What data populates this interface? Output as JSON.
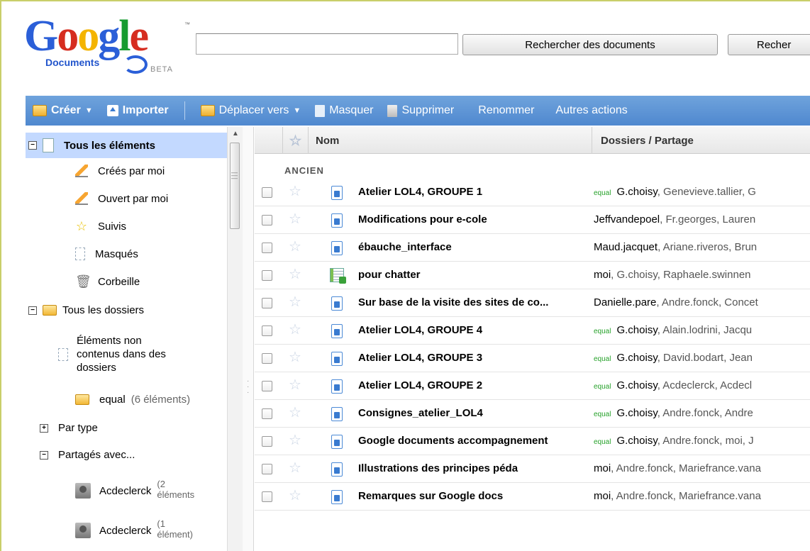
{
  "header": {
    "logo_word": "Google",
    "logo_sub": "Documents",
    "logo_beta": "BETA",
    "search_value": "",
    "btn_search_docs": "Rechercher des documents",
    "btn_search_web": "Recher"
  },
  "toolbar": {
    "create": "Créer",
    "import": "Importer",
    "move": "Déplacer vers",
    "hide": "Masquer",
    "delete": "Supprimer",
    "rename": "Renommer",
    "more": "Autres actions"
  },
  "sidebar": {
    "all_items": "Tous les éléments",
    "created_by_me": "Créés par moi",
    "opened_by_me": "Ouvert par moi",
    "starred": "Suivis",
    "hidden": "Masqués",
    "trash": "Corbeille",
    "all_folders": "Tous les dossiers",
    "unfiled_line1": "Éléments non",
    "unfiled_line2": "contenus dans des",
    "unfiled_line3": "dossiers",
    "folder_equal": "equal",
    "folder_equal_count": "(6 éléments)",
    "by_type": "Par type",
    "shared_with": "Partagés avec...",
    "contacts": [
      {
        "name": "Acdeclerck",
        "count_a": "(2",
        "count_b": "éléments"
      },
      {
        "name": "Acdeclerck",
        "count_a": "(1",
        "count_b": "élément)"
      }
    ]
  },
  "list": {
    "col_name": "Nom",
    "col_folders": "Dossiers / Partage",
    "group": "ANCIEN",
    "rows": [
      {
        "title": "Atelier LOL4, GROUPE 1",
        "type": "doc",
        "tag": "equal",
        "first": "G.choisy",
        "rest": ", Genevieve.tallier, G"
      },
      {
        "title": "Modifications pour e-cole",
        "type": "doc",
        "tag": "",
        "first": "Jeffvandepoel",
        "rest": ", Fr.georges, Lauren"
      },
      {
        "title": "ébauche_interface",
        "type": "doc",
        "tag": "",
        "first": "Maud.jacquet",
        "rest": ", Ariane.riveros, Brun"
      },
      {
        "title": "pour chatter",
        "type": "sheet",
        "tag": "",
        "first": "moi",
        "rest": ", G.choisy, Raphaele.swinnen"
      },
      {
        "title": "Sur base de la visite des sites de co...",
        "type": "doc",
        "tag": "",
        "first": "Danielle.pare",
        "rest": ", Andre.fonck, Concet"
      },
      {
        "title": "Atelier LOL4, GROUPE 4",
        "type": "doc",
        "tag": "equal",
        "first": "G.choisy",
        "rest": ", Alain.lodrini, Jacqu"
      },
      {
        "title": "Atelier LOL4, GROUPE 3",
        "type": "doc",
        "tag": "equal",
        "first": "G.choisy",
        "rest": ", David.bodart, Jean"
      },
      {
        "title": "Atelier LOL4, GROUPE 2",
        "type": "doc",
        "tag": "equal",
        "first": "G.choisy",
        "rest": ", Acdeclerck, Acdecl"
      },
      {
        "title": "Consignes_atelier_LOL4",
        "type": "doc",
        "tag": "equal",
        "first": "G.choisy",
        "rest": ", Andre.fonck, Andre"
      },
      {
        "title": "Google documents accompagnement",
        "type": "doc",
        "tag": "equal",
        "first": "G.choisy",
        "rest": ", Andre.fonck, moi, J"
      },
      {
        "title": "Illustrations des principes péda",
        "type": "doc",
        "tag": "",
        "first": "moi",
        "rest": ", Andre.fonck, Mariefrance.vana"
      },
      {
        "title": "Remarques sur Google docs",
        "type": "doc",
        "tag": "",
        "first": "moi",
        "rest": ", Andre.fonck, Mariefrance.vana"
      }
    ]
  },
  "colors": {
    "toolbar_bg": "#5a92d4",
    "selected_bg": "#c3d9ff",
    "tag_green": "#27a22b",
    "frame_border": "#c9cf6a"
  }
}
